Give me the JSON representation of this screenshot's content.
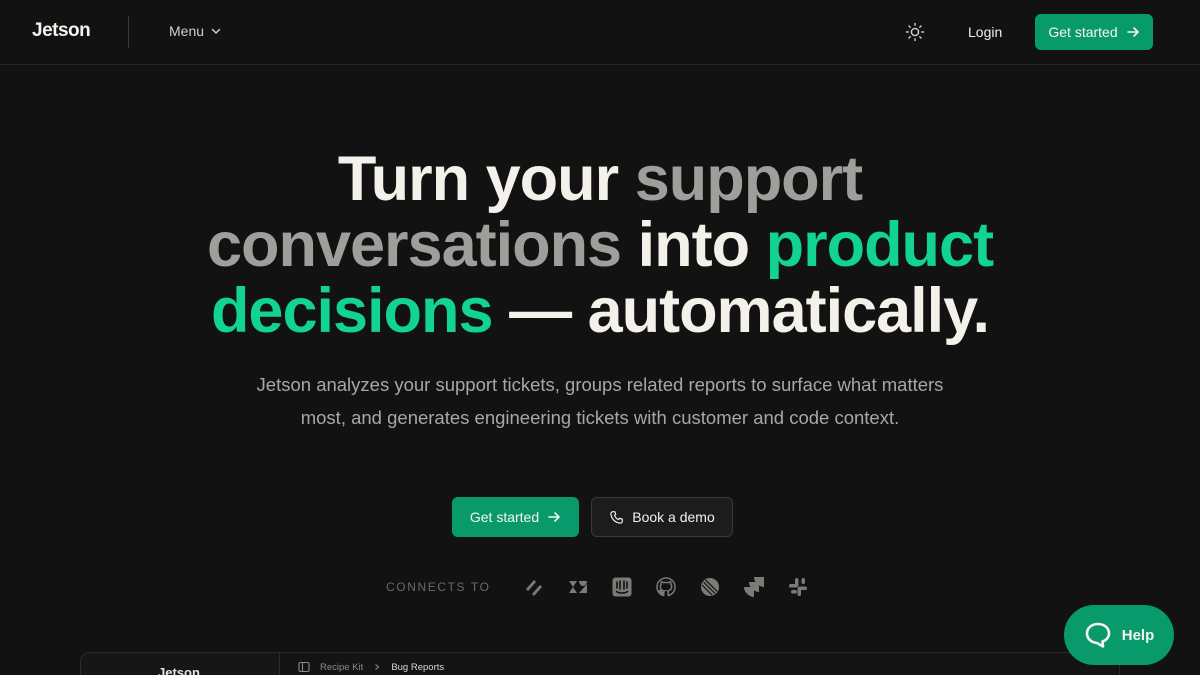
{
  "header": {
    "logo": "Jetson",
    "menu_label": "Menu",
    "login_label": "Login",
    "cta_label": "Get started"
  },
  "hero": {
    "title": {
      "line1_a": "Turn your",
      "line1_b": "support",
      "line2_a": "conversations",
      "line2_b": "into",
      "line2_c": "product",
      "line3_a": "decisions",
      "line3_b": "— automatically."
    },
    "subtitle": "Jetson analyzes your support tickets, groups related reports to surface what matters most, and generates engineering tickets with customer and code context.",
    "primary_cta": "Get started",
    "secondary_cta": "Book a demo",
    "connects_label": "CONNECTS TO",
    "integrations": [
      "zendesk-alt-icon",
      "zendesk-icon",
      "intercom-icon",
      "github-icon",
      "linear-icon",
      "jira-icon",
      "slack-icon"
    ]
  },
  "help": {
    "label": "Help"
  },
  "preview": {
    "logo": "Jetson",
    "breadcrumb_parent": "Recipe Kit",
    "breadcrumb_current": "Bug Reports"
  },
  "colors": {
    "background": "#121212",
    "accent": "#089a6a",
    "accent_text": "#12d38f",
    "muted": "#9e9e9b"
  }
}
